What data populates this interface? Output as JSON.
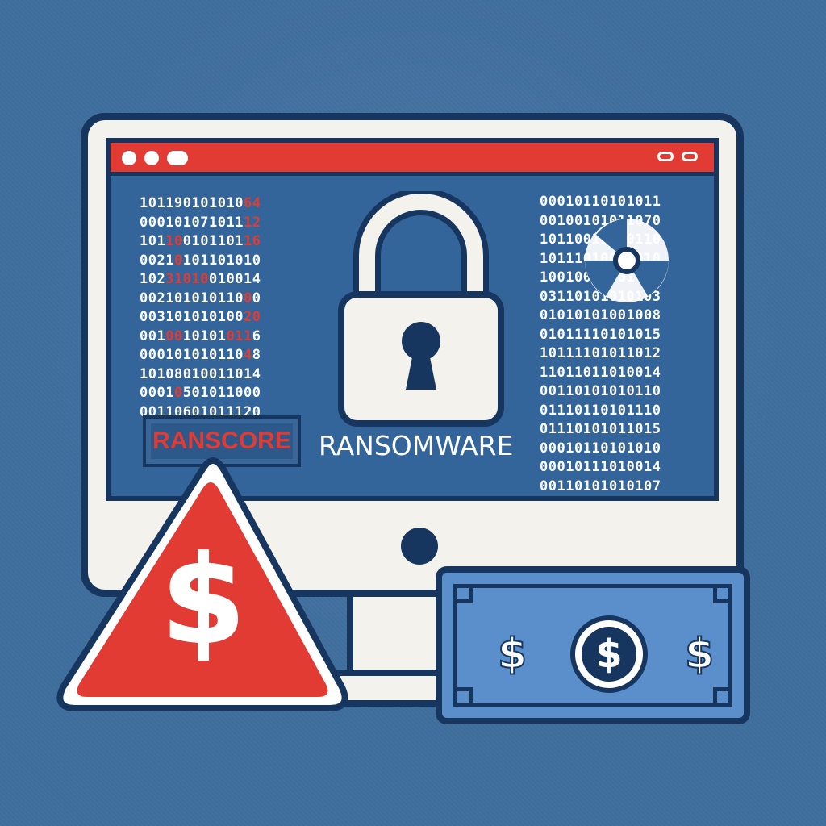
{
  "colors": {
    "background": "#3f6e9d",
    "outline": "#17365f",
    "screen": "#34659a",
    "alert_red": "#e23b34",
    "monitor_body": "#f4f2ec",
    "banknote": "#5a8fcb"
  },
  "screen": {
    "binary_left": [
      "10119010101064",
      "00010107101112",
      "10110010110116",
      "00210101101010",
      "10231010010014",
      "00210101011000",
      "00310101010020",
      "00100101010116",
      "00010101011048",
      "10108010011014",
      "00010501011000",
      "00110601011120"
    ],
    "binary_right": [
      "00010110101011",
      "00100101011070",
      "10110010110110",
      "10111010010010",
      "10010011101010",
      "03110101010103",
      "01010101001008",
      "01011110101015",
      "10111101011012",
      "11011011010014",
      "00110101010110",
      "01110110101110",
      "01110101011015",
      "00010110101010",
      "00010111010014",
      "00110101010107"
    ],
    "ranscore_label": "RANSCORE",
    "ransomware_label": "RANSOMWARE"
  },
  "icons": {
    "lock": "padlock-icon",
    "hazard": "radiation-hazard-icon",
    "warning": "warning-triangle-icon",
    "currency_symbol": "$"
  }
}
